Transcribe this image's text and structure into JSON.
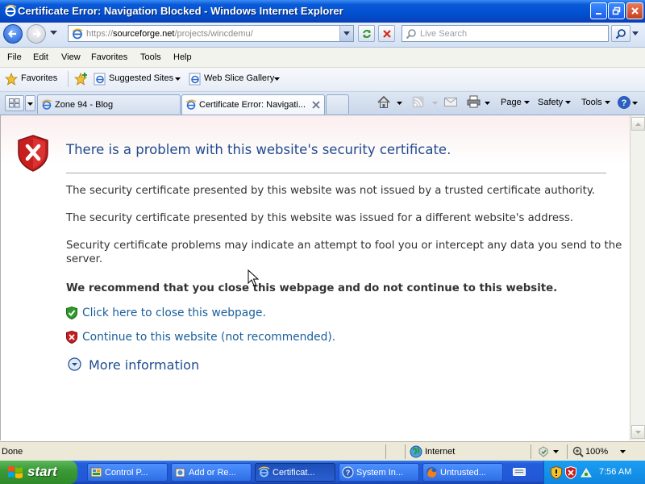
{
  "window": {
    "title": "Certificate Error: Navigation Blocked - Windows Internet Explorer"
  },
  "address_bar": {
    "url_prefix": "https://",
    "url_host": "sourceforge.net",
    "url_path": "/projects/wincdemu/",
    "search_placeholder": "Live Search"
  },
  "menu": [
    "File",
    "Edit",
    "View",
    "Favorites",
    "Tools",
    "Help"
  ],
  "favorites_bar": {
    "favorites_label": "Favorites",
    "items": [
      "Suggested Sites",
      "Web Slice Gallery"
    ]
  },
  "tabs": [
    {
      "label": "Zone 94 - Blog",
      "active": false
    },
    {
      "label": "Certificate Error: Navigati...",
      "active": true
    }
  ],
  "command_bar": {
    "page_label": "Page",
    "safety_label": "Safety",
    "tools_label": "Tools"
  },
  "error_page": {
    "title": "There is a problem with this website's security certificate.",
    "reason_1": "The security certificate presented by this website was not issued by a trusted certificate authority.",
    "reason_2": "The security certificate presented by this website was issued for a different website's address.",
    "warning": "Security certificate problems may indicate an attempt to fool you or intercept any data you send to the server.",
    "recommendation": "We recommend that you close this webpage and do not continue to this website.",
    "close_link": "Click here to close this webpage.",
    "continue_link": "Continue to this website (not recommended).",
    "more_info": "More information"
  },
  "status_bar": {
    "status": "Done",
    "zone": "Internet",
    "zoom": "100%"
  },
  "taskbar": {
    "start_label": "start",
    "tasks": [
      {
        "label": "Control P...",
        "active": false
      },
      {
        "label": "Add or Re...",
        "active": false
      },
      {
        "label": "Certificat...",
        "active": true
      },
      {
        "label": "System In...",
        "active": false
      },
      {
        "label": "Untrusted...",
        "active": false
      }
    ],
    "clock": "7:56 AM"
  },
  "colors": {
    "title_bar": "#0050d0",
    "link_blue": "#1a5e9a",
    "heading_blue": "#1f4b8e",
    "error_red": "#c81e1e",
    "ok_green": "#2f9a2a"
  }
}
